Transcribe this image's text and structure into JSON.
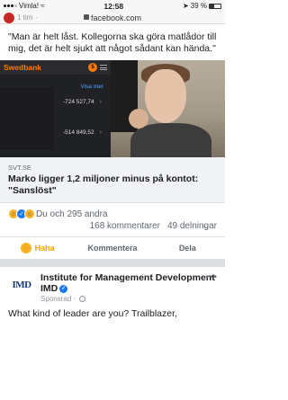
{
  "status_bar": {
    "carrier": "Vimla!",
    "time": "12:58",
    "battery_text": "39 %",
    "battery_level": 0.39
  },
  "url_bar": {
    "time_ago": "1 tim",
    "url": "facebook.com"
  },
  "post": {
    "text": "\"Man är helt låst. Kollegorna ska göra matlådor till mig, det är helt sjukt att något sådant kan hända.\"",
    "media": {
      "bank_name": "Swedbank",
      "notification_count": "5",
      "visa_more": "Visa mer",
      "amount_1": "-724 527,74",
      "amount_2": "-514 849,52"
    },
    "link": {
      "domain": "SVT.SE",
      "title": "Marko ligger 1,2 miljoner minus på kontot: \"Sanslöst\""
    },
    "reactions_text": "Du och 295 andra",
    "comments_count": "168 kommentarer",
    "shares_count": "49 delningar"
  },
  "actions": {
    "haha": "Haha",
    "comment": "Kommentera",
    "share": "Dela"
  },
  "sponsored_post": {
    "logo_text": "IMD",
    "page_name": "Institute for Management Development IMD",
    "sponsored_label": "Sponsrad",
    "text_preview": "What kind of leader are you? Trailblazer,"
  },
  "colors": {
    "accent": "#1877f2",
    "haha": "#f0a400",
    "bank_orange": "#ff7a00"
  }
}
